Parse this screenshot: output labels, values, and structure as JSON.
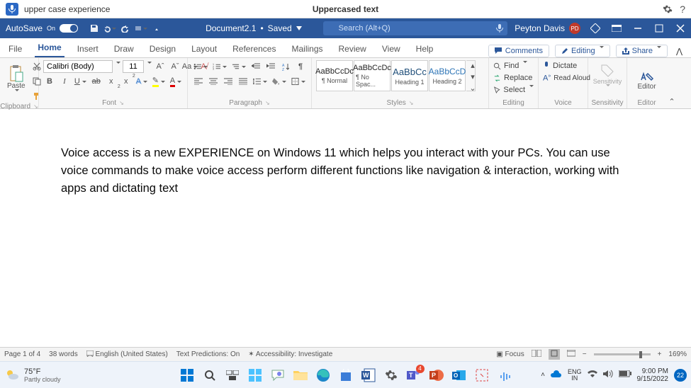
{
  "voice_bar": {
    "left_text": "upper case experience",
    "center_text": "Uppercased text"
  },
  "title_bar": {
    "autosave_label": "AutoSave",
    "autosave_state": "On",
    "document_name": "Document2.1",
    "saved_state": "Saved",
    "search_placeholder": "Search (Alt+Q)",
    "user_name": "Peyton Davis",
    "user_initials": "PD"
  },
  "tabs": {
    "items": [
      "File",
      "Home",
      "Insert",
      "Draw",
      "Design",
      "Layout",
      "References",
      "Mailings",
      "Review",
      "View",
      "Help"
    ],
    "active_index": 1,
    "right": {
      "comments": "Comments",
      "editing": "Editing",
      "share": "Share"
    }
  },
  "ribbon": {
    "clipboard": {
      "paste": "Paste",
      "label": "Clipboard"
    },
    "font": {
      "name": "Calibri (Body)",
      "size": "11",
      "grow": "Aˆ",
      "shrink": "Aˇ",
      "case": "Aa",
      "clear": "A⧸",
      "label": "Font"
    },
    "paragraph": {
      "label": "Paragraph"
    },
    "styles": {
      "sample": "AaBbCcDc",
      "sample_short": "AaBbCc",
      "sample_shorter": "AaBbCcD",
      "names": [
        "¶ Normal",
        "¶ No Spac...",
        "Heading 1",
        "Heading 2"
      ],
      "label": "Styles"
    },
    "editing": {
      "find": "Find",
      "replace": "Replace",
      "select": "Select",
      "label": "Editing"
    },
    "voice": {
      "dictate": "Dictate",
      "read_aloud": "Read Aloud",
      "label": "Voice"
    },
    "sensitivity": {
      "name": "Sensitivity",
      "label": "Sensitivity"
    },
    "editor": {
      "name": "Editor",
      "label": "Editor"
    }
  },
  "document": {
    "paragraph": "Voice access is a new EXPERIENCE on Windows 11 which helps you interact with your PCs. You can use voice commands to make voice access perform different functions like navigation & interaction, working with apps and dictating text"
  },
  "status": {
    "page": "Page 1 of 4",
    "words": "38 words",
    "language": "English (United States)",
    "predictions": "Text Predictions: On",
    "accessibility": "Accessibility: Investigate",
    "focus": "Focus",
    "zoom": "169%"
  },
  "taskbar": {
    "temp": "75°F",
    "weather": "Partly cloudy",
    "teams_badge": "4",
    "lang1": "ENG",
    "lang2": "IN",
    "time": "9:00 PM",
    "date": "9/15/2022",
    "notif_count": "22"
  }
}
